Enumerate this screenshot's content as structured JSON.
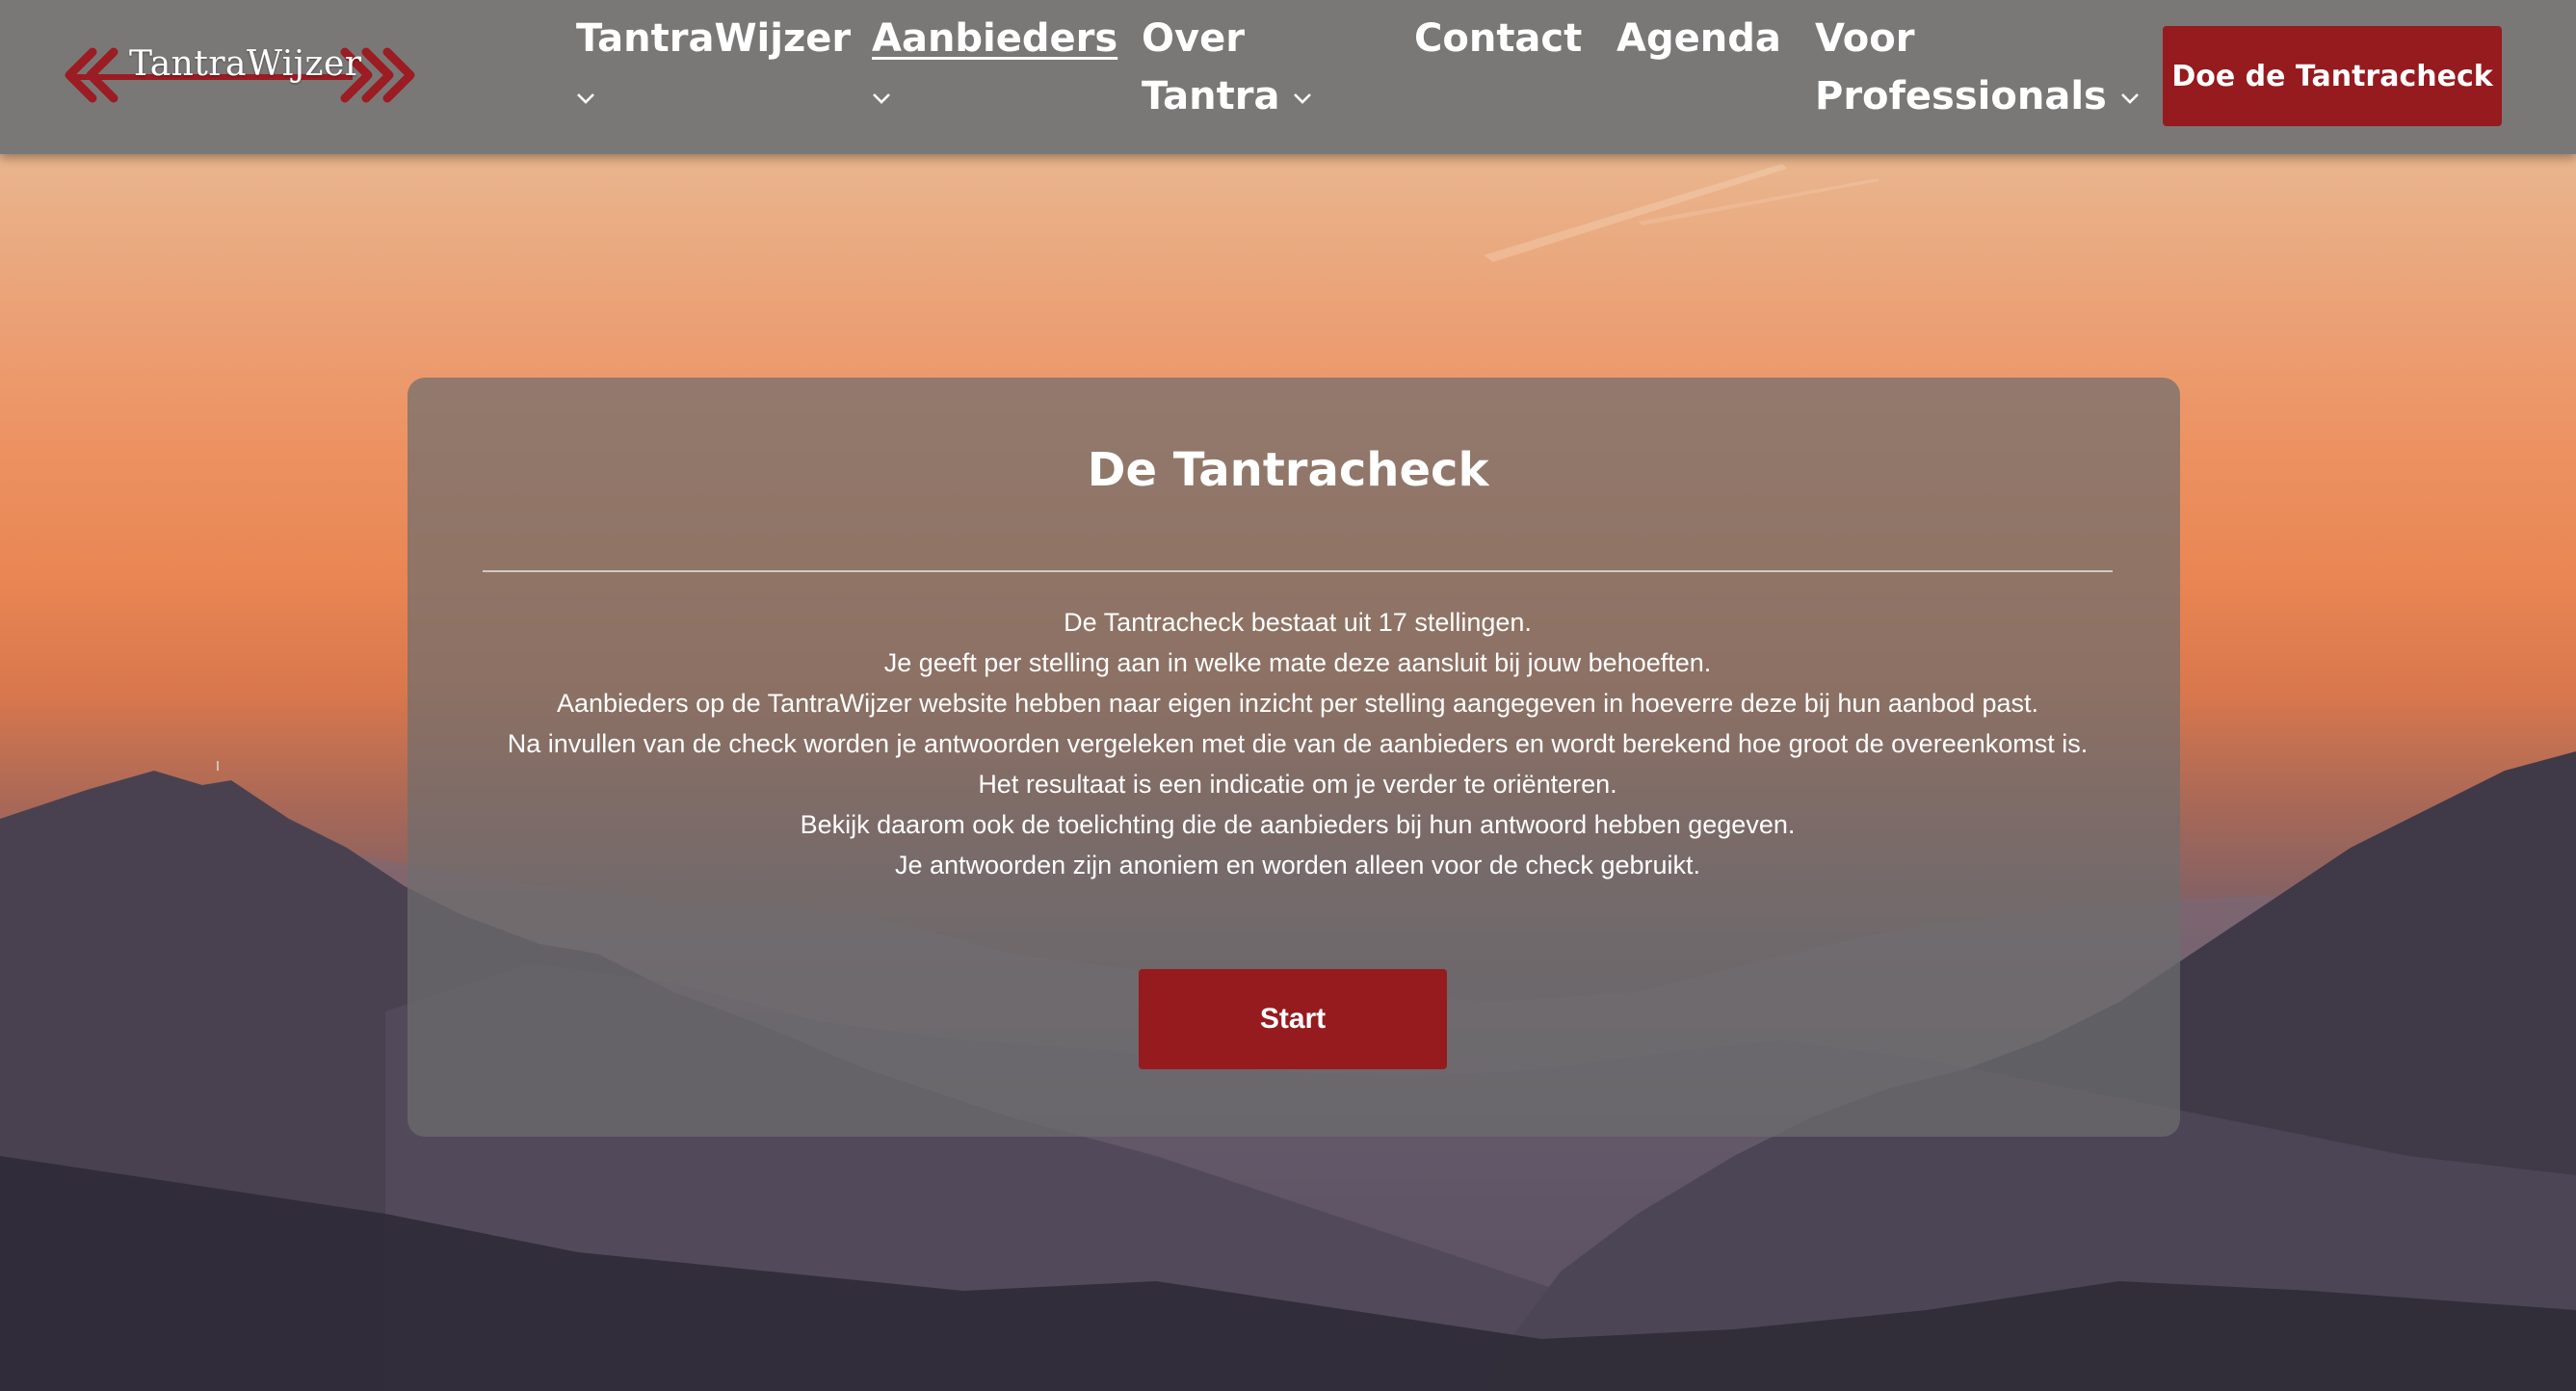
{
  "brand": {
    "logo_text": "TantraWijzer",
    "accent_color": "#961b1e"
  },
  "nav": {
    "items": [
      {
        "lines": [
          "TantraWijzer"
        ],
        "has_dropdown": true,
        "active": false
      },
      {
        "lines": [
          "Aanbieders"
        ],
        "has_dropdown": true,
        "active": true
      },
      {
        "lines": [
          "Over",
          "Tantra"
        ],
        "has_dropdown": true,
        "active": false
      },
      {
        "lines": [
          "Contact"
        ],
        "has_dropdown": false,
        "active": false
      },
      {
        "lines": [
          "Agenda"
        ],
        "has_dropdown": false,
        "active": false
      },
      {
        "lines": [
          "Voor",
          "Professionals"
        ],
        "has_dropdown": true,
        "active": false
      }
    ],
    "cta_label": "Doe de Tantracheck",
    "dropdown_icon": "chevron-down-icon"
  },
  "check": {
    "title": "De Tantracheck",
    "paragraphs": [
      "De Tantracheck bestaat uit 17 stellingen.",
      "Je geeft per stelling aan in welke mate deze aansluit bij jouw behoeften.",
      "Aanbieders op de TantraWijzer website hebben naar eigen inzicht per stelling aangegeven in hoeverre deze bij hun aanbod past.",
      "Na invullen van de check worden je antwoorden vergeleken met die van de aanbieders en wordt berekend hoe groot de overeenkomst is.",
      "Het resultaat is een indicatie om je verder te oriënteren.",
      "Bekijk daarom ook de toelichting die de aanbieders bij hun antwoord hebben gegeven.",
      "Je antwoorden zijn anoniem en worden alleen voor de check gebruikt."
    ],
    "start_label": "Start"
  }
}
